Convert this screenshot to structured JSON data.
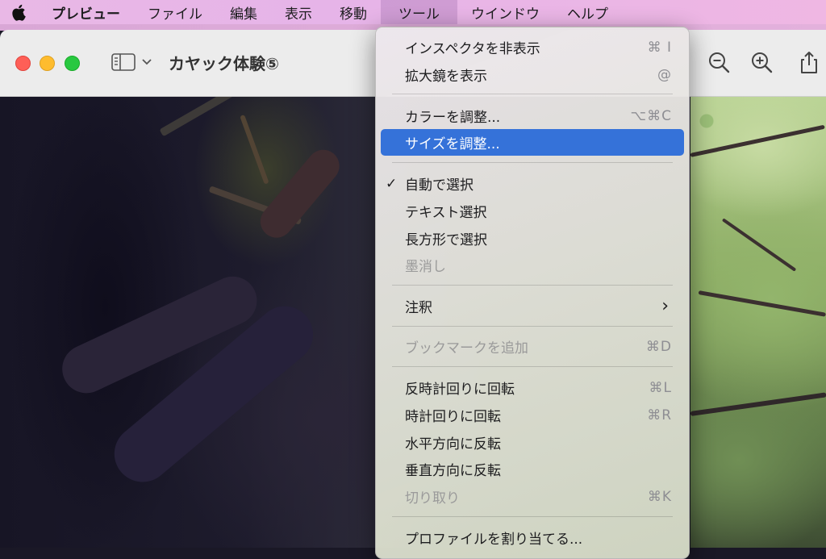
{
  "menubar": {
    "app_name": "プレビュー",
    "items": [
      "ファイル",
      "編集",
      "表示",
      "移動",
      "ツール",
      "ウインドウ",
      "ヘルプ"
    ],
    "active_item": "ツール"
  },
  "window": {
    "title": "カヤック体験⑤"
  },
  "menu": {
    "items": [
      {
        "label": "インスペクタを非表示",
        "shortcut": "⌘ I"
      },
      {
        "label": "拡大鏡を表示",
        "shortcut": "@"
      },
      {
        "label": "カラーを調整...",
        "shortcut": "⌥⌘C"
      },
      {
        "label": "サイズを調整...",
        "shortcut": ""
      },
      {
        "label": "自動で選択",
        "check": "✓"
      },
      {
        "label": "テキスト選択"
      },
      {
        "label": "長方形で選択"
      },
      {
        "label": "墨消し"
      },
      {
        "label": "注釈",
        "submenu_arrow": "›"
      },
      {
        "label": "ブックマークを追加",
        "shortcut": "⌘D"
      },
      {
        "label": "反時計回りに回転",
        "shortcut": "⌘L"
      },
      {
        "label": "時計回りに回転",
        "shortcut": "⌘R"
      },
      {
        "label": "水平方向に反転"
      },
      {
        "label": "垂直方向に反転"
      },
      {
        "label": "切り取り",
        "shortcut": "⌘K"
      },
      {
        "label": "プロファイルを割り当てる..."
      }
    ],
    "highlighted_item": "サイズを調整...",
    "disabled_items": [
      "墨消し",
      "ブックマークを追加",
      "切り取り"
    ]
  },
  "colors": {
    "menubar_bg": "#e9b8e6",
    "highlight": "#3572d9",
    "traffic_red": "#fe5f57",
    "traffic_yellow": "#febc2e",
    "traffic_green": "#28c840"
  },
  "icons": {
    "apple": "apple-logo-icon",
    "sidebar": "sidebar-toggle-icon",
    "zoom_out": "zoom-out-icon",
    "zoom_in": "zoom-in-icon",
    "share": "share-icon"
  }
}
